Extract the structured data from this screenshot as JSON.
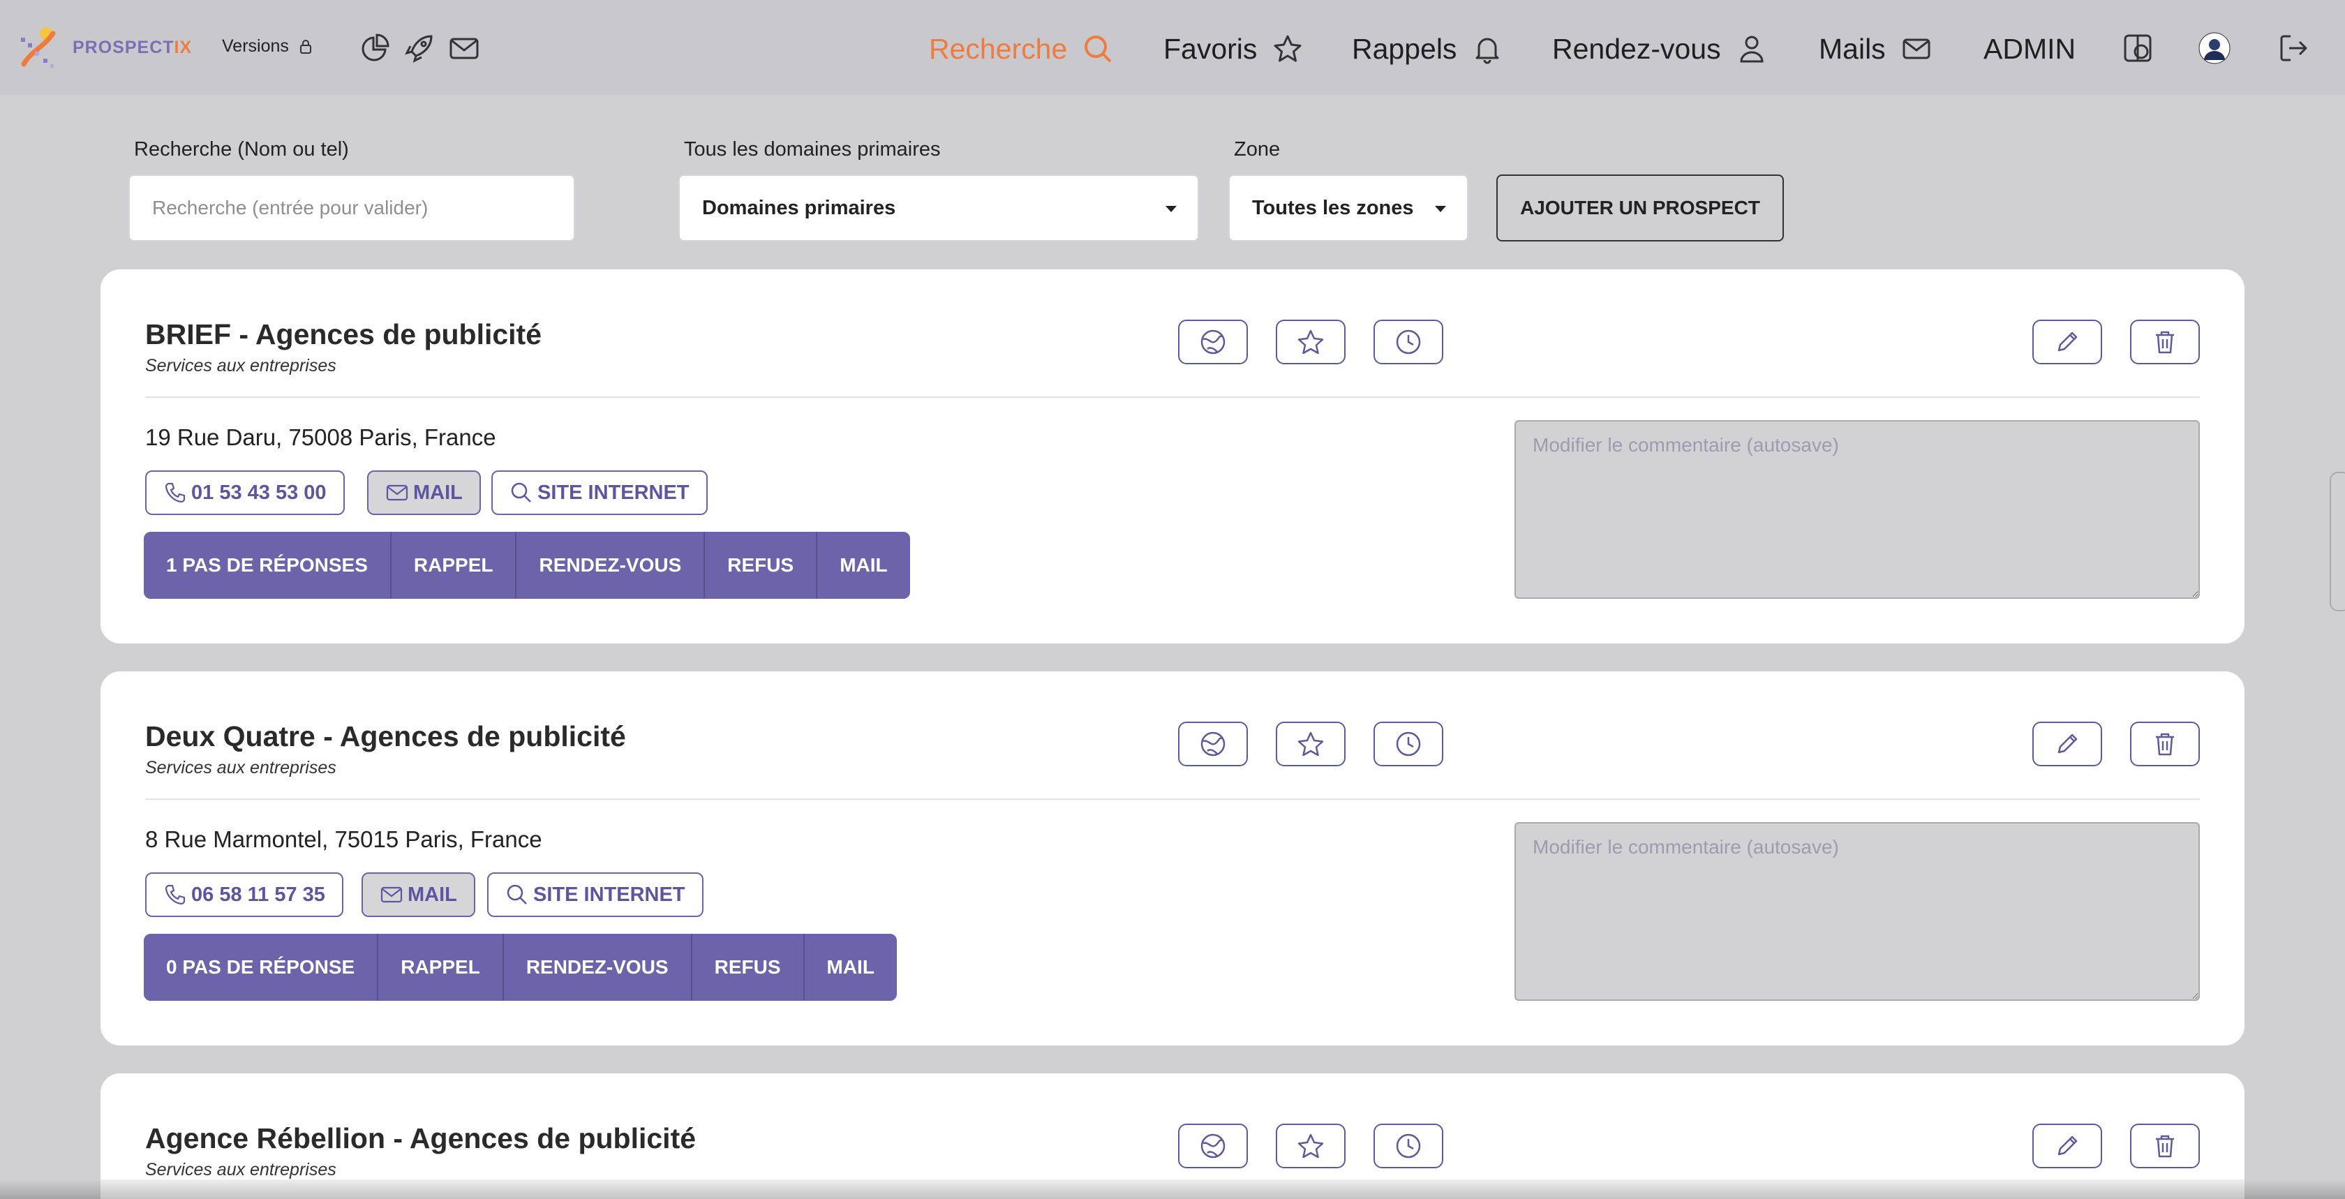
{
  "brand": {
    "name_a": "PROSPECT",
    "name_b": "IX",
    "accent": "#f07b3f",
    "primary": "#6c63ab"
  },
  "nav": {
    "versions_label": "Versions",
    "links": [
      {
        "label": "Recherche",
        "icon": "search-icon",
        "active": true
      },
      {
        "label": "Favoris",
        "icon": "star-icon"
      },
      {
        "label": "Rappels",
        "icon": "bell-icon"
      },
      {
        "label": "Rendez-vous",
        "icon": "user-icon"
      },
      {
        "label": "Mails",
        "icon": "mail-icon"
      },
      {
        "label": "ADMIN"
      }
    ]
  },
  "filters": {
    "search_label": "Recherche (Nom ou tel)",
    "search_placeholder": "Recherche (entrée pour valider)",
    "domain_label": "Tous les domaines primaires",
    "domain_value": "Domaines primaires",
    "zone_label": "Zone",
    "zone_value": "Toutes les zones",
    "add_button": "AJOUTER UN PROSPECT"
  },
  "prospects": [
    {
      "title": "BRIEF - Agences de publicité",
      "subtitle": "Services aux entreprises",
      "address": "19 Rue Daru, 75008 Paris, France",
      "phone": "01 53 43 53 00",
      "mail_label": "MAIL",
      "site_label": "SITE INTERNET",
      "actions": [
        "1 PAS DE RÉPONSES",
        "RAPPEL",
        "RENDEZ-VOUS",
        "REFUS",
        "MAIL"
      ],
      "comment_placeholder": "Modifier le commentaire (autosave)"
    },
    {
      "title": "Deux Quatre - Agences de publicité",
      "subtitle": "Services aux entreprises",
      "address": "8 Rue Marmontel, 75015 Paris, France",
      "phone": "06 58 11 57 35",
      "mail_label": "MAIL",
      "site_label": "SITE INTERNET",
      "actions": [
        "0 PAS DE RÉPONSE",
        "RAPPEL",
        "RENDEZ-VOUS",
        "REFUS",
        "MAIL"
      ],
      "comment_placeholder": "Modifier le commentaire (autosave)"
    },
    {
      "title": "Agence Rébellion - Agences de publicité",
      "subtitle": "Services aux entreprises"
    }
  ]
}
